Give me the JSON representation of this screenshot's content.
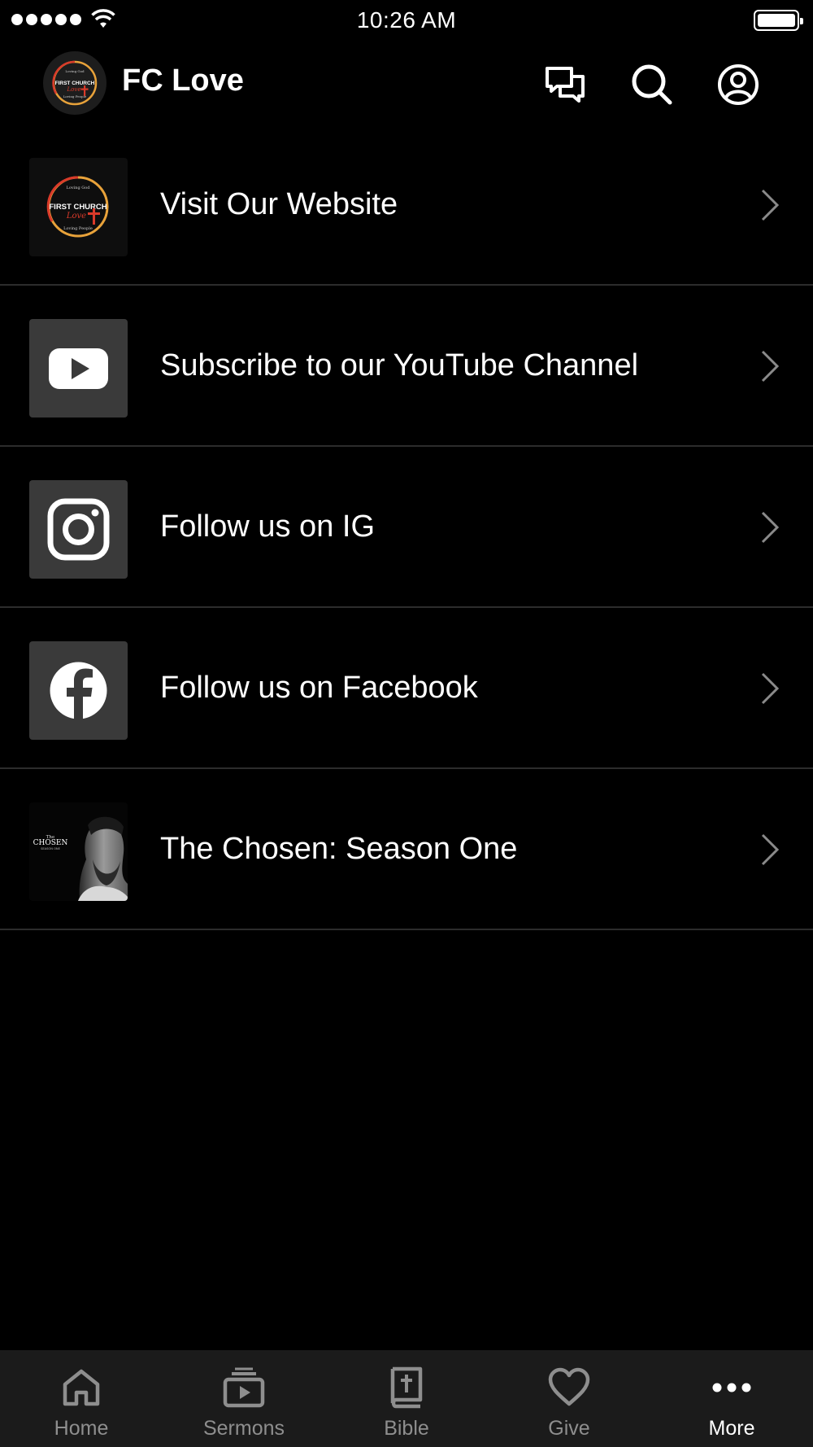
{
  "status_bar": {
    "time": "10:26 AM"
  },
  "header": {
    "title": "FC Love"
  },
  "logo": {
    "line_top": "Loving God",
    "line_main": "FIRST CHURCH",
    "line_script": "Love",
    "line_bottom": "Loving People"
  },
  "menu": {
    "items": [
      {
        "label": "Visit Our Website",
        "icon": "church-logo"
      },
      {
        "label": "Subscribe to our YouTube Channel",
        "icon": "youtube-icon"
      },
      {
        "label": "Follow us on IG",
        "icon": "instagram-icon"
      },
      {
        "label": "Follow us on Facebook",
        "icon": "facebook-icon"
      },
      {
        "label": "The Chosen: Season One",
        "icon": "chosen-poster",
        "poster": {
          "the": "The",
          "title": "CHOSEN",
          "season": "SEASON ONE"
        }
      }
    ]
  },
  "tabs": [
    {
      "label": "Home",
      "active": false
    },
    {
      "label": "Sermons",
      "active": false
    },
    {
      "label": "Bible",
      "active": false
    },
    {
      "label": "Give",
      "active": false
    },
    {
      "label": "More",
      "active": true
    }
  ],
  "colors": {
    "background": "#000000",
    "divider": "#2c2c2c",
    "tab_bar": "#1b1b1b",
    "tab_inactive": "#8e8e8e",
    "tab_active": "#ffffff",
    "icon_tile": "#3a3a3a"
  }
}
